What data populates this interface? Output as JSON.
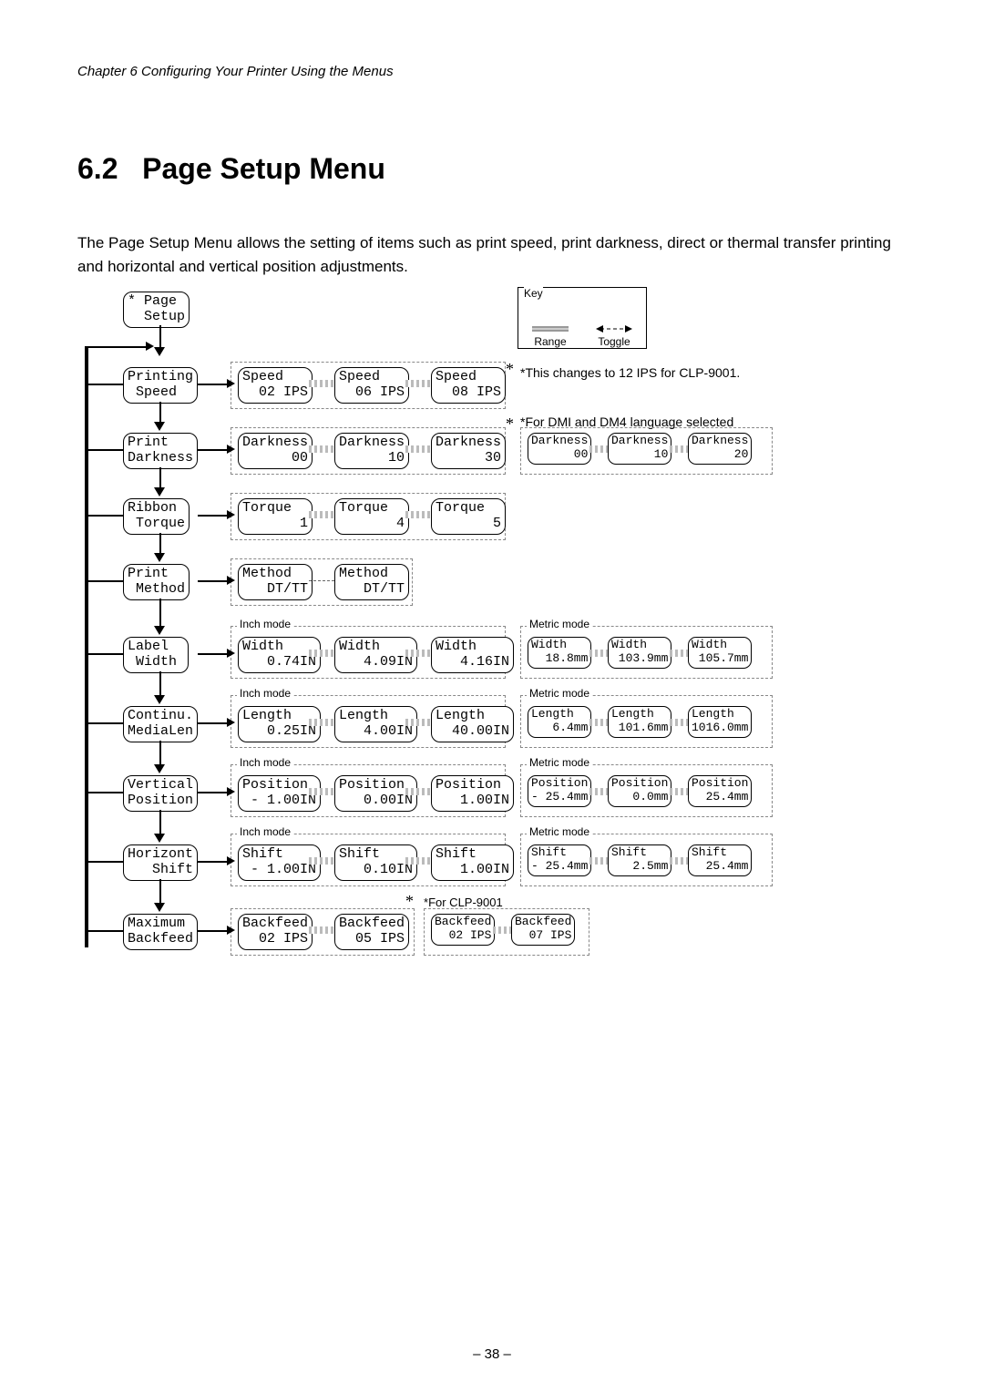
{
  "chapter_head": "Chapter 6   Configuring Your Printer Using the Menus",
  "section_number": "6.2",
  "section_title": "Page Setup Menu",
  "intro": "The Page Setup Menu allows the setting of items such as print speed, print darkness, direct or thermal transfer printing and horizontal and vertical position adjustments.",
  "page_number": "– 38 –",
  "key": {
    "title": "Key",
    "range_label": "Range",
    "toggle_label": "Toggle"
  },
  "notes": {
    "speed_clp9001": "This changes to 12 IPS for CLP-9001.",
    "dmi_dm4": "For DMI and DM4 language selected",
    "inch_mode": "Inch mode",
    "metric_mode": "Metric mode",
    "for_clp9001": "For CLP-9001"
  },
  "menu": {
    "root": "* Page\n  Setup",
    "rows": [
      {
        "name": "Printing\n Speed",
        "inch": [
          "Speed\n  02 IPS",
          "Speed\n  06 IPS",
          "Speed\n  08 IPS"
        ]
      },
      {
        "name": "Print\nDarkness",
        "std": [
          "Darkness\n      00",
          "Darkness\n      10",
          "Darkness\n      30"
        ],
        "alt": [
          "Darkness\n      00",
          "Darkness\n      10",
          "Darkness\n      20"
        ]
      },
      {
        "name": "Ribbon\n Torque",
        "std": [
          "Torque\n       1",
          "Torque\n       4",
          "Torque\n       5"
        ]
      },
      {
        "name": "Print\n Method",
        "std": [
          "Method\n   DT/TT",
          "Method\n   DT/TT"
        ]
      },
      {
        "name": "Label\n Width",
        "inch": [
          "Width\n   0.74IN",
          "Width\n   4.09IN",
          "Width\n   4.16IN"
        ],
        "metric": [
          "Width\n  18.8mm",
          "Width\n 103.9mm",
          "Width\n 105.7mm"
        ]
      },
      {
        "name": "Continu.\nMediaLen",
        "inch": [
          "Length\n   0.25IN",
          "Length\n   4.00IN",
          "Length\n  40.00IN"
        ],
        "metric": [
          "Length\n   6.4mm",
          "Length\n 101.6mm",
          "Length\n1016.0mm"
        ]
      },
      {
        "name": "Vertical\nPosition",
        "inch": [
          "Position\n - 1.00IN",
          "Position\n   0.00IN",
          "Position\n   1.00IN"
        ],
        "metric": [
          "Position\n- 25.4mm",
          "Position\n   0.0mm",
          "Position\n  25.4mm"
        ]
      },
      {
        "name": "Horizont\n   Shift",
        "inch": [
          "Shift\n - 1.00IN",
          "Shift\n   0.10IN",
          "Shift\n   1.00IN"
        ],
        "metric": [
          "Shift\n- 25.4mm",
          "Shift\n   2.5mm",
          "Shift\n  25.4mm"
        ]
      },
      {
        "name": "Maximum\nBackfeed",
        "inch": [
          "Backfeed\n  02 IPS",
          "Backfeed\n  05 IPS"
        ],
        "alt": [
          "Backfeed\n  02 IPS",
          "Backfeed\n  07 IPS"
        ]
      }
    ]
  }
}
